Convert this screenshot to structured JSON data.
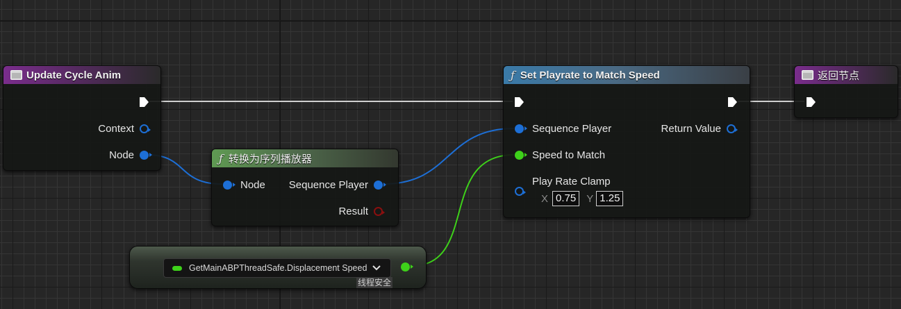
{
  "nodes": {
    "update_cycle_anim": {
      "title": "Update Cycle Anim",
      "pins": {
        "context": "Context",
        "node": "Node"
      }
    },
    "convert_node": {
      "title": "转换为序列播放器",
      "pins": {
        "node": "Node",
        "sequence_player": "Sequence Player",
        "result": "Result"
      }
    },
    "set_playrate": {
      "title": "Set Playrate to Match Speed",
      "pins": {
        "sequence_player": "Sequence Player",
        "speed_to_match": "Speed to Match",
        "play_rate_clamp": "Play Rate Clamp",
        "return_value": "Return Value"
      },
      "clamp": {
        "x_label": "X",
        "x_value": "0.75",
        "y_label": "Y",
        "y_value": "1.25"
      }
    },
    "return_node": {
      "title": "返回节点"
    },
    "getter": {
      "label": "GetMainABPThreadSafe.Displacement Speed",
      "badge": "线程安全"
    }
  },
  "colors": {
    "exec_wire": "#d9d9d9",
    "object_pin": "#1d6fd6",
    "float_pin": "#3ed11a",
    "result_pin": "#8a0f0f"
  },
  "icons": {
    "event": "event-node-icon",
    "function": "function-icon",
    "exec": "exec-pin-icon",
    "dropdown": "chevron-down-icon"
  }
}
